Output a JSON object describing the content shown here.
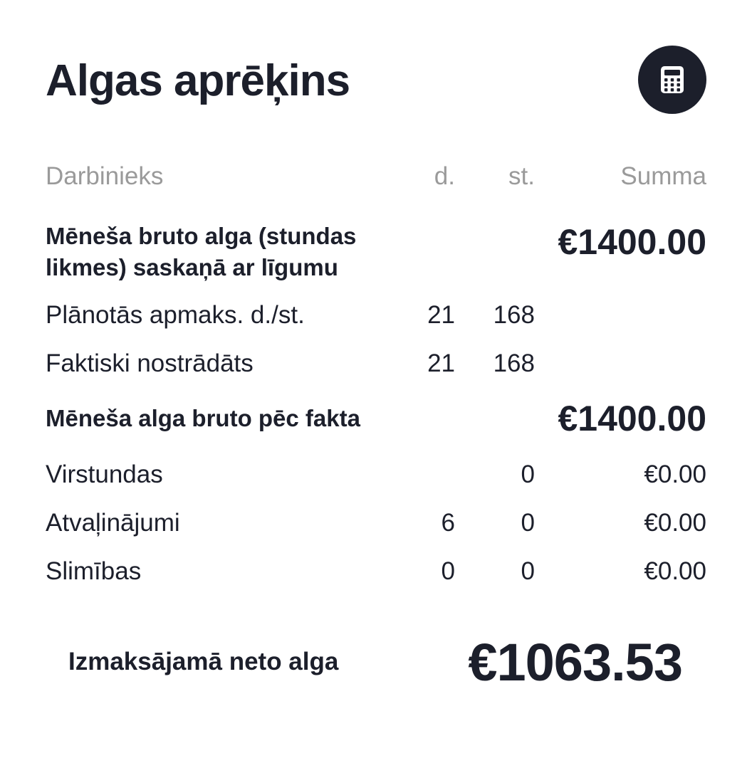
{
  "header": {
    "title": "Algas aprēķins",
    "calculator_icon": "calculator-icon"
  },
  "table": {
    "columns": {
      "employee": "Darbinieks",
      "days": "d.",
      "hours": "st.",
      "sum": "Summa"
    },
    "contract_gross": {
      "label_line1": "Mēneša bruto alga (stundas",
      "label_line2": "likmes) saskaņā ar līgumu",
      "sum": "€1400.00"
    },
    "planned": {
      "label": "Plānotās apmaks. d./st.",
      "days": "21",
      "hours": "168"
    },
    "actual": {
      "label": "Faktiski nostrādāts",
      "days": "21",
      "hours": "168"
    },
    "actual_gross": {
      "label": "Mēneša alga bruto pēc fakta",
      "sum": "€1400.00"
    },
    "overtime": {
      "label": "Virstundas",
      "hours": "0",
      "sum": "€0.00"
    },
    "vacations": {
      "label": "Atvaļinājumi",
      "days": "6",
      "hours": "0",
      "sum": "€0.00"
    },
    "sickness": {
      "label": "Slimības",
      "days": "0",
      "hours": "0",
      "sum": "€0.00"
    }
  },
  "net": {
    "label": "Izmaksājamā neto alga",
    "value": "€1063.53"
  },
  "colors": {
    "text": "#1c1f2b",
    "muted": "#9a9a9a",
    "button_bg": "#1c1f2b",
    "icon": "#ffffff"
  }
}
